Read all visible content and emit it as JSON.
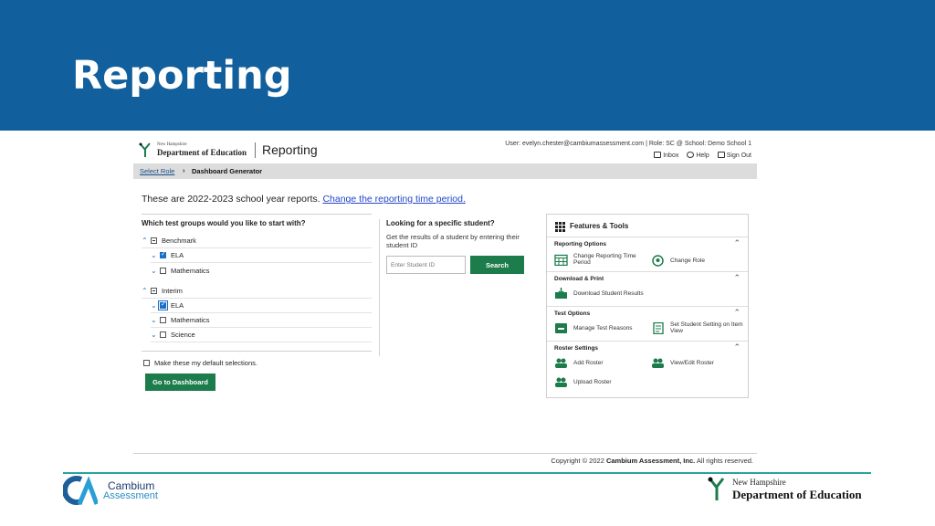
{
  "slide": {
    "title": "Reporting"
  },
  "header": {
    "org_small": "New Hampshire",
    "org_big": "Department of Education",
    "app_title": "Reporting",
    "user_info": "User: evelyn.chester@cambiumassessment.com  |  Role: SC @ School: Demo School 1",
    "links": {
      "inbox": "Inbox",
      "help": "Help",
      "signout": "Sign Out"
    }
  },
  "breadcrumb": {
    "link": "Select Role",
    "current": "Dashboard Generator"
  },
  "intro": {
    "text": "These are 2022-2023 school year reports. ",
    "link": "Change the reporting time period."
  },
  "test_groups": {
    "question": "Which test groups would you like to start with?",
    "benchmark": {
      "label": "Benchmark",
      "items": [
        "ELA",
        "Mathematics"
      ]
    },
    "interim": {
      "label": "Interim",
      "items": [
        "ELA",
        "Mathematics",
        "Science"
      ]
    },
    "default_label": "Make these my default selections.",
    "go_button": "Go to Dashboard"
  },
  "student_search": {
    "question": "Looking for a specific student?",
    "description": "Get the results of a student by entering their student ID",
    "placeholder": "Enter Student ID",
    "button": "Search"
  },
  "features": {
    "title": "Features & Tools",
    "reporting_options": {
      "heading": "Reporting Options",
      "change_period": "Change Reporting Time Period",
      "change_role": "Change Role"
    },
    "download_print": {
      "heading": "Download & Print",
      "download_results": "Download Student Results"
    },
    "test_options": {
      "heading": "Test Options",
      "manage_reasons": "Manage Test Reasons",
      "set_setting": "Set Student Setting on Item View"
    },
    "roster_settings": {
      "heading": "Roster Settings",
      "add_roster": "Add Roster",
      "view_edit_roster": "View/Edit Roster",
      "upload_roster": "Upload Roster"
    }
  },
  "footer": {
    "prefix": "Copyright © 2022 ",
    "company": "Cambium Assessment, Inc.",
    "suffix": " All rights reserved."
  },
  "branding": {
    "cambium_line1": "Cambium",
    "cambium_line2": "Assessment",
    "nh_small": "New Hampshire",
    "nh_big": "Department of Education"
  },
  "colors": {
    "banner": "#115f9c",
    "green_button": "#1c7c4b",
    "link_blue": "#2245c8",
    "accent_teal": "#2aa39a"
  }
}
